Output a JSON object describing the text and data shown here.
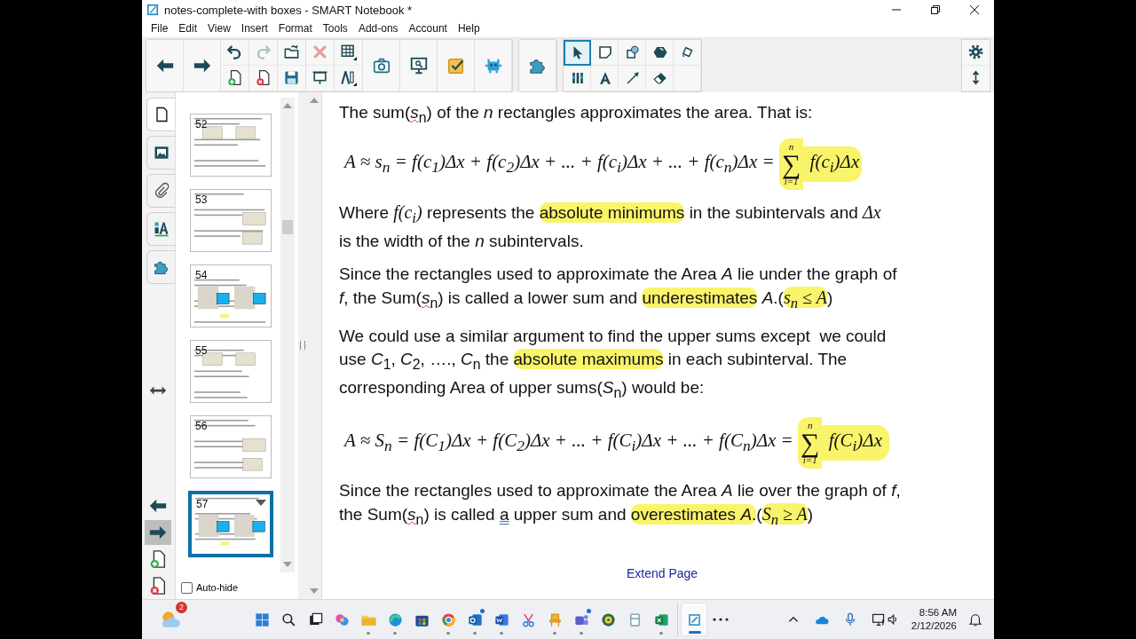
{
  "window": {
    "title": "notes-complete-with boxes - SMART Notebook *"
  },
  "menu": [
    "File",
    "Edit",
    "View",
    "Insert",
    "Format",
    "Tools",
    "Add-ons",
    "Account",
    "Help"
  ],
  "toolbar": {
    "buttons": [
      {
        "disabled": false
      },
      {
        "disabled": false
      },
      {
        "disabled": false
      },
      {
        "disabled": false
      },
      {
        "disabled": true
      },
      {
        "disabled": false
      },
      {
        "disabled": false
      },
      {
        "disabled": false
      },
      {
        "disabled": true
      },
      {
        "disabled": false
      },
      {
        "disabled": false
      },
      {
        "disabled": false
      },
      {
        "disabled": false
      },
      {
        "disabled": false
      },
      {
        "disabled": false
      },
      {
        "disabled": false
      },
      {
        "disabled": false
      },
      {
        "disabled": false
      },
      {
        "disabled": false
      }
    ],
    "tools": [
      {
        "selected": true
      },
      {
        "selected": false
      },
      {
        "selected": false
      },
      {
        "selected": false
      },
      {
        "selected": false
      },
      {
        "selected": false
      },
      {
        "selected": false
      },
      {
        "selected": false
      },
      {
        "selected": false
      }
    ]
  },
  "side_tabs": [
    {
      "selected": true
    },
    {
      "selected": false
    },
    {
      "selected": false
    },
    {
      "selected": false
    },
    {
      "selected": false
    }
  ],
  "pages": [
    {
      "number": "52",
      "selected": false
    },
    {
      "number": "53",
      "selected": false
    },
    {
      "number": "54",
      "selected": false
    },
    {
      "number": "55",
      "selected": false
    },
    {
      "number": "56",
      "selected": false
    },
    {
      "number": "57",
      "selected": true
    }
  ],
  "auto_hide": {
    "label": "Auto-hide",
    "checked": false
  },
  "content": [
    {
      "kind": "paragraph",
      "lines": [
        [
          {
            "kind": "text",
            "text": "The sum(",
            "highlighted": false
          },
          {
            "kind": "text",
            "text": "*s*$_{n}$",
            "highlighted": false,
            "misspelled": true
          },
          {
            "kind": "text",
            "text": ") of the *n* rectangles approximates the area. That is:",
            "highlighted": false
          }
        ]
      ]
    },
    {
      "kind": "formula",
      "segments": [
        {
          "kind": "math",
          "text": "A ≈ s$_{n}$ = f(c$_{1}$)Δx + f(c$_{2}$)Δx + ... + f(c$_{i}$)Δx + ... + f(c$_{n}$)Δx = ",
          "highlighted": false
        },
        {
          "kind": "sum",
          "symbol": "∑",
          "upper": "n",
          "lower": "i=1",
          "highlighted": true
        },
        {
          "kind": "math",
          "text": " f(c$_{i}$)Δx",
          "highlighted": true
        }
      ]
    },
    {
      "kind": "paragraph",
      "lines": [
        [
          {
            "kind": "text",
            "text": "Where ",
            "highlighted": false
          },
          {
            "kind": "math",
            "text": "f(c$_{i}$)",
            "highlighted": false
          },
          {
            "kind": "text",
            "text": " represents the ",
            "highlighted": false
          },
          {
            "kind": "text",
            "text": "absolute minimums",
            "highlighted": true
          },
          {
            "kind": "text",
            "text": " in the subintervals and ",
            "highlighted": false
          },
          {
            "kind": "math",
            "text": "Δx",
            "highlighted": false
          }
        ],
        [
          {
            "kind": "text",
            "text": "is the width of the *n* subintervals.",
            "highlighted": false
          }
        ]
      ]
    },
    {
      "kind": "paragraph",
      "lines": [
        [
          {
            "kind": "text",
            "text": "Since the rectangles used to approximate the Area *A* lie under the graph of",
            "highlighted": false
          }
        ],
        [
          {
            "kind": "text",
            "text": "*f*, the Sum(",
            "highlighted": false
          },
          {
            "kind": "text",
            "text": "*s*$_{n}$",
            "highlighted": false,
            "misspelled": true
          },
          {
            "kind": "text",
            "text": ") is called a lower sum and ",
            "highlighted": false
          },
          {
            "kind": "text",
            "text": "underestimates",
            "highlighted": true
          },
          {
            "kind": "text",
            "text": " *A*.(",
            "highlighted": false
          },
          {
            "kind": "math",
            "text": "s$_{n}$ ≤ A",
            "highlighted": true
          },
          {
            "kind": "text",
            "text": ")",
            "highlighted": false
          }
        ]
      ]
    },
    {
      "kind": "paragraph",
      "lines": [
        [
          {
            "kind": "text",
            "text": "We could use a similar argument to find the upper sums except  we could",
            "highlighted": false
          }
        ],
        [
          {
            "kind": "text",
            "text": "use *C*$_{1}$, *C*$_{2}$, …., *C*$_{n}$ the ",
            "highlighted": false
          },
          {
            "kind": "text",
            "text": "absolute maximums",
            "highlighted": true
          },
          {
            "kind": "text",
            "text": " in each subinterval. The",
            "highlighted": false
          }
        ],
        [
          {
            "kind": "text",
            "text": "corresponding Area of upper sums(*S*$_{n}$) would be:",
            "highlighted": false
          }
        ]
      ]
    },
    {
      "kind": "formula",
      "segments": [
        {
          "kind": "math",
          "text": "A ≈ S$_{n}$ = f(C$_{1}$)Δx + f(C$_{2}$)Δx + ... + f(C$_{i}$)Δx + ... + f(C$_{n}$)Δx = ",
          "highlighted": false
        },
        {
          "kind": "sum",
          "symbol": "∑",
          "upper": "n",
          "lower": "i=1",
          "highlighted": true
        },
        {
          "kind": "math",
          "text": " f(C$_{i}$)Δx ",
          "highlighted": true
        }
      ]
    },
    {
      "kind": "paragraph",
      "lines": [
        [
          {
            "kind": "text",
            "text": "Since the rectangles used to approximate the Area *A* lie over the graph of *f*,",
            "highlighted": false
          }
        ],
        [
          {
            "kind": "text",
            "text": "the Sum(",
            "highlighted": false
          },
          {
            "kind": "text",
            "text": "*s*$_{n}$",
            "highlighted": false,
            "misspelled": true
          },
          {
            "kind": "text",
            "text": ") is called ",
            "highlighted": false
          },
          {
            "kind": "text",
            "text": "a",
            "highlighted": false,
            "grammar_error": true
          },
          {
            "kind": "text",
            "text": " upper sum and ",
            "highlighted": false
          },
          {
            "kind": "text",
            "text": "overestimates *A*.",
            "highlighted": true
          },
          {
            "kind": "text",
            "text": "(",
            "highlighted": false
          },
          {
            "kind": "math",
            "text": "S$_{n}$ ≥ A",
            "highlighted": true
          },
          {
            "kind": "text",
            "text": ")",
            "highlighted": false
          }
        ]
      ]
    }
  ],
  "extend_page": "Extend Page",
  "taskbar": {
    "weather_badge": "2",
    "apps": [
      {
        "running": false,
        "active": false,
        "notify": false
      },
      {
        "running": false,
        "active": false,
        "notify": false
      },
      {
        "running": false,
        "active": false,
        "notify": false
      },
      {
        "running": false,
        "active": false,
        "notify": false
      },
      {
        "running": true,
        "active": false,
        "notify": false
      },
      {
        "running": true,
        "active": false,
        "notify": false
      },
      {
        "running": false,
        "active": false,
        "notify": false
      },
      {
        "running": true,
        "active": false,
        "notify": false
      },
      {
        "running": true,
        "active": false,
        "notify": true
      },
      {
        "running": true,
        "active": false,
        "notify": false
      },
      {
        "running": false,
        "active": false,
        "notify": false
      },
      {
        "running": true,
        "active": false,
        "notify": false
      },
      {
        "running": true,
        "active": false,
        "notify": true
      },
      {
        "running": false,
        "active": false,
        "notify": false
      },
      {
        "running": false,
        "active": false,
        "notify": false
      },
      {
        "running": true,
        "active": false,
        "notify": false
      },
      {
        "running": true,
        "active": true,
        "notify": false
      }
    ],
    "time": "8:56 AM",
    "date": "2/12/2026"
  }
}
